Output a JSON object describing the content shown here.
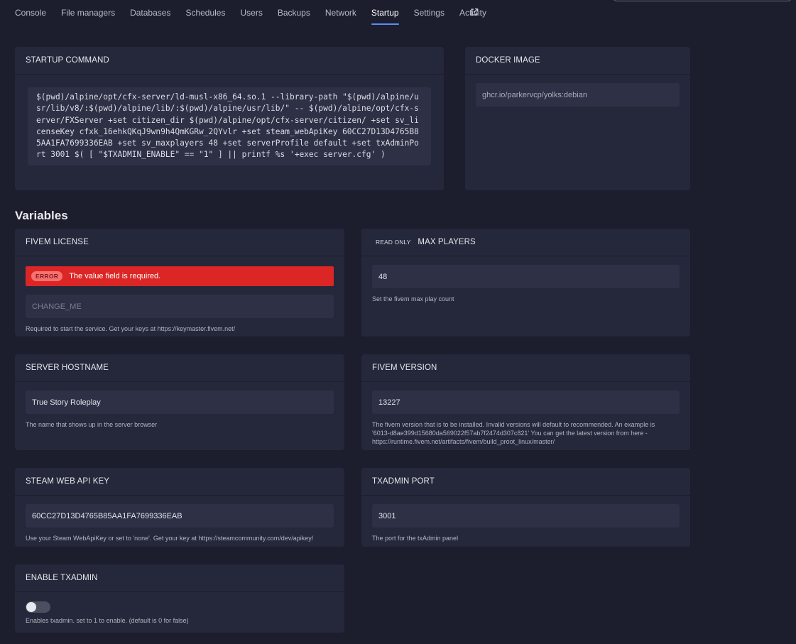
{
  "nav": {
    "items": [
      "Console",
      "File managers",
      "Databases",
      "Schedules",
      "Users",
      "Backups",
      "Network",
      "Startup",
      "Settings",
      "Activity"
    ],
    "active": "Startup"
  },
  "startup": {
    "title": "STARTUP COMMAND",
    "command": "$(pwd)/alpine/opt/cfx-server/ld-musl-x86_64.so.1 --library-path \"$(pwd)/alpine/usr/lib/v8/:$(pwd)/alpine/lib/:$(pwd)/alpine/usr/lib/\" -- $(pwd)/alpine/opt/cfx-server/FXServer +set citizen_dir $(pwd)/alpine/opt/cfx-server/citizen/ +set sv_licenseKey cfxk_16ehkQKqJ9wn9h4QmKGRw_2QYvlr +set steam_webApiKey 60CC27D13D4765B85AA1FA7699336EAB +set sv_maxplayers 48 +set serverProfile default +set txAdminPort 3001 $( [ \"$TXADMIN_ENABLE\" == \"1\" ] || printf %s '+exec server.cfg' )"
  },
  "docker": {
    "title": "DOCKER IMAGE",
    "value": "ghcr.io/parkervcp/yolks:debian"
  },
  "variables_title": "Variables",
  "vars": {
    "license": {
      "title": "FIVEM LICENSE",
      "error_badge": "ERROR",
      "error_text": "The value field is required.",
      "placeholder": "CHANGE_ME",
      "help": "Required to start the service. Get your keys at https://keymaster.fivem.net/"
    },
    "maxplayers": {
      "readonly_label": "READ ONLY",
      "title": "MAX PLAYERS",
      "value": "48",
      "help": "Set the fivem max play count"
    },
    "hostname": {
      "title": "SERVER HOSTNAME",
      "value": "True Story Roleplay",
      "help": "The name that shows up in the server browser"
    },
    "version": {
      "title": "FIVEM VERSION",
      "value": "13227",
      "help": "The fivem version that is to be installed. Invalid versions will default to recommended. An example is '6013-d8ae399d15680da569022f57ab7f2474d307c821' You can get the latest version from here - https://runtime.fivem.net/artifacts/fivem/build_proot_linux/master/"
    },
    "steamkey": {
      "title": "STEAM WEB API KEY",
      "value": "60CC27D13D4765B85AA1FA7699336EAB",
      "help": "Use your Steam WebApiKey or set to 'none'. Get your key at https://steamcommunity.com/dev/apikey/"
    },
    "txport": {
      "title": "TXADMIN PORT",
      "value": "3001",
      "help": "The port for the txAdmin panel"
    },
    "txenable": {
      "title": "ENABLE TXADMIN",
      "enabled": false,
      "help": "Enables txadmin. set to 1 to enable. (default is 0 for false)"
    }
  },
  "icons": {
    "external": "external-link-icon"
  },
  "colors": {
    "accent": "#5b8def",
    "error": "#dc2626",
    "background": "#1c1e2e",
    "card": "#25273a"
  }
}
